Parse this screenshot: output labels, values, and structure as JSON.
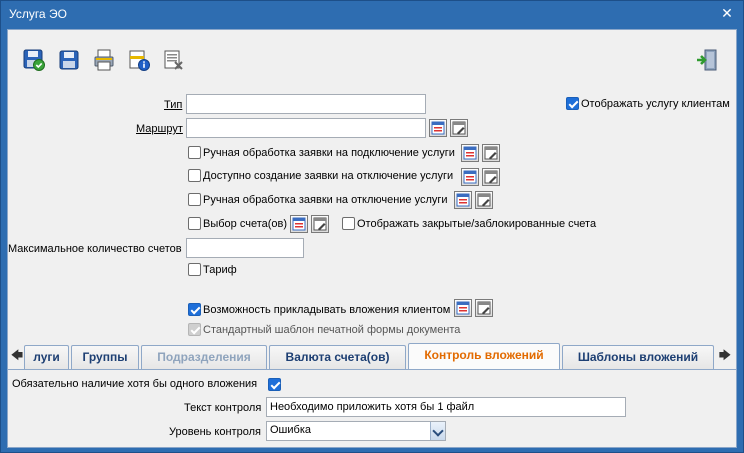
{
  "window": {
    "title": "Услуга ЭО",
    "close_glyph": "✕"
  },
  "toolbar": {
    "buttons": [
      {
        "name": "save-close-icon"
      },
      {
        "name": "save-icon"
      },
      {
        "name": "print-icon"
      },
      {
        "name": "info-icon"
      },
      {
        "name": "cancel-icon"
      }
    ],
    "exit_icon": "exit-door-icon"
  },
  "form": {
    "type_label": "Тип",
    "type_value": "",
    "route_label": "Маршрут",
    "route_value": "",
    "show_to_clients_label": "Отображать услугу клиентам",
    "show_to_clients_checked": true,
    "manual_connect_label": "Ручная обработка заявки на подключение услуги",
    "manual_connect_checked": false,
    "allow_disconnect_label": "Доступно создание заявки на отключение услуги",
    "allow_disconnect_checked": false,
    "manual_disconnect_label": "Ручная обработка заявки на отключение услуги",
    "manual_disconnect_checked": false,
    "choose_accounts_label": "Выбор счета(ов)",
    "choose_accounts_checked": false,
    "show_closed_label": "Отображать закрытые/заблокированные счета",
    "show_closed_checked": false,
    "max_accounts_label": "Максимальное количество счетов",
    "max_accounts_value": "",
    "tariff_label": "Тариф",
    "tariff_checked": false,
    "attachments_label": "Возможность прикладывать вложения клиентом",
    "attachments_checked": true,
    "standard_template_label": "Стандартный шаблон печатной формы документа",
    "standard_template_checked": true
  },
  "tabs": {
    "left_arrow": "🡄",
    "right_arrow": "🡆",
    "items": [
      {
        "label": "луги",
        "state": "normal"
      },
      {
        "label": "Группы",
        "state": "normal"
      },
      {
        "label": "Подразделения",
        "state": "disabled"
      },
      {
        "label": "Валюта счета(ов)",
        "state": "normal"
      },
      {
        "label": "Контроль вложений",
        "state": "active"
      },
      {
        "label": "Шаблоны вложений",
        "state": "normal"
      }
    ]
  },
  "control_tab": {
    "required_label": "Обязательно наличие хотя бы одного вложения",
    "required_checked": true,
    "control_text_label": "Текст контроля",
    "control_text_value": "Необходимо приложить хотя бы 1 файл",
    "control_level_label": "Уровень контроля",
    "control_level_value": "Ошибка"
  },
  "colors": {
    "title_bar": "#2e6db1",
    "active_tab": "#e26a00",
    "tab_text": "#1d3f73"
  }
}
